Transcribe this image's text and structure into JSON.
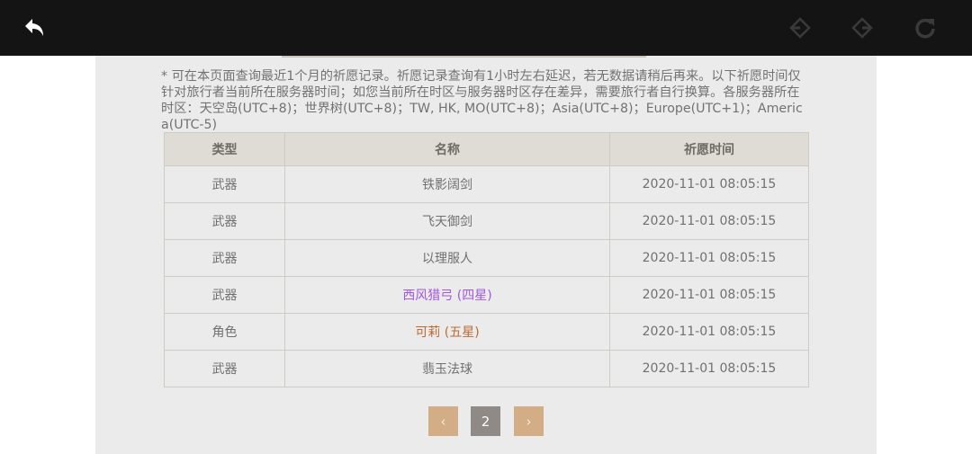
{
  "toolbar": {
    "back_icon": "undo-arrow-icon",
    "nav_back_icon": "diamond-left-icon",
    "nav_forward_icon": "diamond-right-icon",
    "refresh_icon": "refresh-icon"
  },
  "notice_text": "* 可在本页面查询最近1个月的祈愿记录。祈愿记录查询有1小时左右延迟，若无数据请稍后再来。以下祈愿时间仅针对旅行者当前所在服务器时间；如您当前所在时区与服务器时区存在差异，需要旅行者自行换算。各服务器所在时区：天空岛(UTC+8)；世界树(UTC+8)；TW, HK, MO(UTC+8)；Asia(UTC+8)；Europe(UTC+1)；America(UTC-5)",
  "table": {
    "headers": [
      "类型",
      "名称",
      "祈愿时间"
    ],
    "rows": [
      {
        "type": "武器",
        "name": "铁影阔剑",
        "time": "2020-11-01 08:05:15",
        "name_color": "#707070"
      },
      {
        "type": "武器",
        "name": "飞天御剑",
        "time": "2020-11-01 08:05:15",
        "name_color": "#707070"
      },
      {
        "type": "武器",
        "name": "以理服人",
        "time": "2020-11-01 08:05:15",
        "name_color": "#707070"
      },
      {
        "type": "武器",
        "name": "西风猎弓 (四星)",
        "time": "2020-11-01 08:05:15",
        "name_color": "#a256e1"
      },
      {
        "type": "角色",
        "name": "可莉 (五星)",
        "time": "2020-11-01 08:05:15",
        "name_color": "#bd6932"
      },
      {
        "type": "武器",
        "name": "翡玉法球",
        "time": "2020-11-01 08:05:15",
        "name_color": "#707070"
      }
    ]
  },
  "pagination": {
    "prev_label": "‹",
    "current_page": "2",
    "next_label": "›"
  }
}
